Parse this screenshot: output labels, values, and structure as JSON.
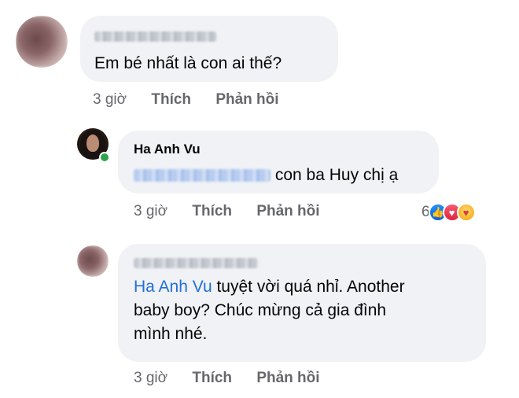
{
  "comments": [
    {
      "author": "",
      "text": "Em bé nhất là con ai thế?",
      "meta": {
        "time": "3 giờ",
        "like": "Thích",
        "reply": "Phản hồi"
      }
    },
    {
      "author": "Ha Anh Vu",
      "text": "con ba Huy chị ạ",
      "meta": {
        "time": "3 giờ",
        "like": "Thích",
        "reply": "Phản hồi"
      },
      "reactions": {
        "count": "6",
        "icons": [
          "like-icon",
          "love-icon",
          "care-icon"
        ]
      }
    },
    {
      "author": "",
      "mention": "Ha Anh Vu",
      "text_line1": " tuyệt vời quá nhỉ. Another",
      "text_line2": "baby boy? Chúc mừng cả gia đình",
      "text_line3": "mình nhé.",
      "meta": {
        "time": "3 giờ",
        "like": "Thích",
        "reply": "Phản hồi"
      }
    }
  ],
  "colors": {
    "bubble": "#f0f2f5",
    "meta": "#65676b",
    "mention": "#216fdb",
    "online": "#31a24c"
  }
}
